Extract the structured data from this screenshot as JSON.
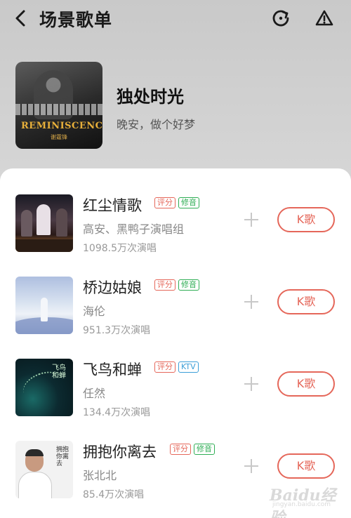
{
  "header": {
    "title": "场景歌单",
    "icons": [
      "back-icon",
      "refresh-icon",
      "warning-icon"
    ]
  },
  "playlist": {
    "name": "独处时光",
    "description": "晚安，做个好梦",
    "cover_logo": "REMINISCENCE",
    "cover_sub": "谢霆锋"
  },
  "songs": [
    {
      "title": "红尘情歌",
      "tags": [
        "评分",
        "修音"
      ],
      "artist": "高安、黑鸭子演唱组",
      "plays": "1098.5万次演唱",
      "button": "K歌"
    },
    {
      "title": "桥边姑娘",
      "tags": [
        "评分",
        "修音"
      ],
      "artist": "海伦",
      "plays": "951.3万次演唱",
      "button": "K歌"
    },
    {
      "title": "飞鸟和蝉",
      "tags": [
        "评分",
        "KTV"
      ],
      "artist": "任然",
      "plays": "134.4万次演唱",
      "button": "K歌"
    },
    {
      "title": "拥抱你离去",
      "tags": [
        "评分",
        "修音"
      ],
      "artist": "张北北",
      "plays": "85.4万次演唱",
      "button": "K歌"
    }
  ],
  "thumb_text": {
    "song3": "飞鸟和蝉",
    "song4": "拥抱你离去"
  },
  "watermark": {
    "line1": "Baidu经验",
    "line2": "jingyan.baidu.com"
  },
  "colors": {
    "accent": "#e5675a",
    "tag_green": "#2fae55",
    "tag_blue": "#3b9ed8"
  }
}
